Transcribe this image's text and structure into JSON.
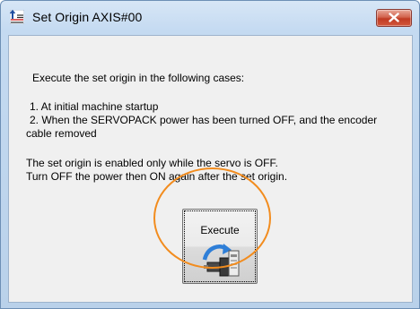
{
  "window": {
    "title": "Set Origin AXIS#00",
    "close_icon": "close-icon",
    "app_icon": "set-origin-icon"
  },
  "content": {
    "intro": "Execute the set origin in the following cases:",
    "case1": " 1. At initial machine startup",
    "case2": " 2. When the SERVOPACK power has been turned OFF, and the encoder",
    "case2_cont": "cable removed",
    "note1": "The set origin is enabled only while the servo is OFF.",
    "note2": "Turn OFF the power then ON again after the set origin."
  },
  "execute_button": {
    "label": "Execute",
    "icon": "servo-motor-icon"
  },
  "colors": {
    "highlight_ring": "#f28c1e",
    "close_button": "#c13b23",
    "titlebar": "#c4daf1"
  }
}
